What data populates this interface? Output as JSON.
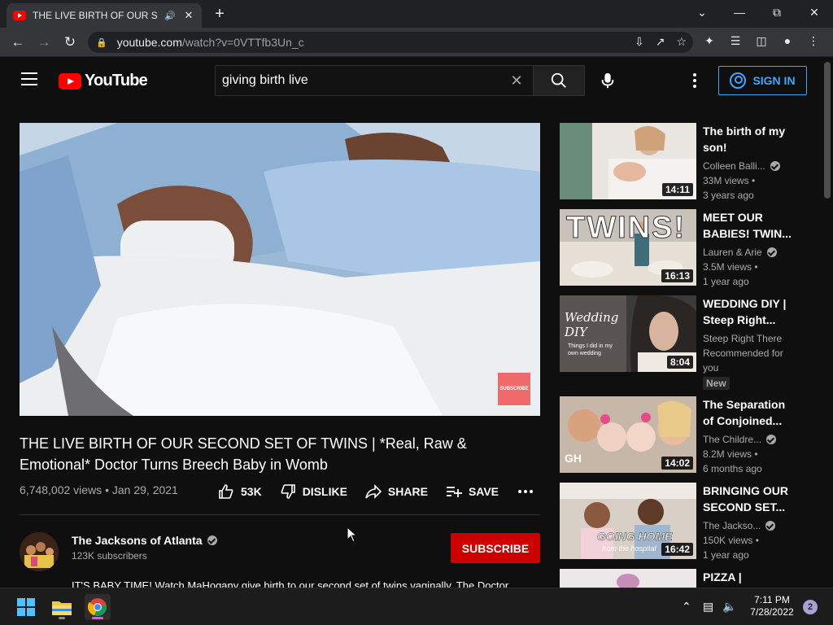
{
  "browser": {
    "tab_title": "THE LIVE BIRTH OF OUR SECOND SET OF TWINS | *Real, Raw & Emotional* Doctor Turns Breech Baby in Womb - YouTube",
    "url_host": "youtube.com",
    "url_path": "/watch?v=0VTTfb3Un_c"
  },
  "header": {
    "logo_text": "YouTube",
    "search_value": "giving birth live",
    "sign_in_label": "SIGN IN"
  },
  "video": {
    "watermark": "SUBSCRIBE",
    "title": "THE LIVE BIRTH OF OUR SECOND SET OF TWINS | *Real, Raw & Emotional* Doctor Turns Breech Baby in Womb",
    "views": "6,748,002 views",
    "date": "Jan 29, 2021",
    "likes": "53K",
    "dislike_label": "DISLIKE",
    "share_label": "SHARE",
    "save_label": "SAVE",
    "channel_name": "The Jacksons of Atlanta",
    "subscribers": "123K subscribers",
    "subscribe_label": "SUBSCRIBE",
    "description": "IT'S BABY TIME! Watch MaHogany give birth to our second set of twins vaginally. The Doctor"
  },
  "recommendations": [
    {
      "title": "The birth of my son!",
      "channel": "Colleen Balli...",
      "verified": true,
      "views": "33M views",
      "age": "3 years ago",
      "duration": "14:11",
      "badge": "",
      "extra": ""
    },
    {
      "title": "MEET OUR BABIES! TWIN...",
      "channel": "Lauren & Arie",
      "verified": true,
      "views": "3.5M views",
      "age": "1 year ago",
      "duration": "16:13",
      "badge": "",
      "extra": "",
      "thumb_text": "TWINS!"
    },
    {
      "title": "WEDDING DIY | Steep Right...",
      "channel": "Steep Right There",
      "verified": false,
      "views": "",
      "age": "",
      "duration": "8:04",
      "badge": "New",
      "extra": "Recommended for you",
      "thumb_text": "Wedding DIY",
      "thumb_sub": "Things I did in my own wedding"
    },
    {
      "title": "The Separation of Conjoined...",
      "channel": "The Childre...",
      "verified": true,
      "views": "8.2M views",
      "age": "6 months ago",
      "duration": "14:02",
      "badge": "",
      "extra": "",
      "thumb_text": "GH"
    },
    {
      "title": "BRINGING OUR SECOND SET...",
      "channel": "The Jackso...",
      "verified": true,
      "views": "150K views",
      "age": "1 year ago",
      "duration": "16:42",
      "badge": "",
      "extra": "",
      "thumb_text": "GOING HOME",
      "thumb_sub": "from the hospital"
    },
    {
      "title": "PIZZA |",
      "channel": "",
      "verified": false,
      "views": "",
      "age": "",
      "duration": "",
      "badge": "",
      "extra": ""
    }
  ],
  "taskbar": {
    "time": "7:11 PM",
    "date": "7/28/2022",
    "notifications": "2"
  }
}
